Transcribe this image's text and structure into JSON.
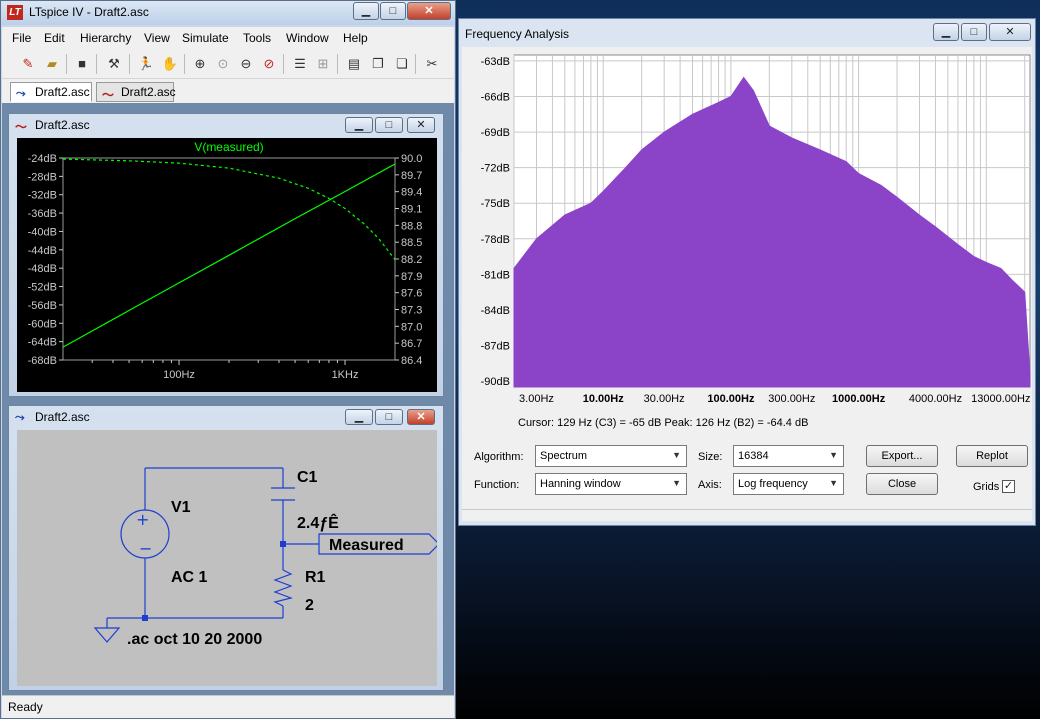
{
  "lt_window": {
    "title": "LTspice IV - Draft2.asc",
    "menu": [
      "File",
      "Edit",
      "Hierarchy",
      "View",
      "Simulate",
      "Tools",
      "Window",
      "Help"
    ],
    "tabs": [
      "Draft2.asc",
      "Draft2.asc"
    ],
    "status": "Ready"
  },
  "plot_window": {
    "title": "Draft2.asc",
    "trace_name": "V(measured)",
    "colors": {
      "trace": "#00ff00",
      "background": "#000000",
      "grid": "#808080"
    }
  },
  "schematic_window": {
    "title": "Draft2.asc",
    "labels": {
      "v1": "V1",
      "ac": "AC 1",
      "c1": "C1",
      "c1_value": "2.4ƒÊ",
      "r1": "R1",
      "r1_value": "2",
      "net": "Measured",
      "directive": ".ac oct 10 20 2000"
    }
  },
  "fa_window": {
    "title": "Frequency Analysis",
    "cursor_text": "Cursor: 129 Hz (C3) = -65 dB   Peak: 126 Hz (B2) = -64.4 dB",
    "algorithm": {
      "label": "Algorithm:",
      "value": "Spectrum"
    },
    "size": {
      "label": "Size:",
      "value": "16384"
    },
    "function": {
      "label": "Function:",
      "value": "Hanning window"
    },
    "axis": {
      "label": "Axis:",
      "value": "Log frequency"
    },
    "buttons": {
      "export": "Export...",
      "replot": "Replot",
      "close": "Close"
    },
    "grids": {
      "label": "Grids",
      "checked": true,
      "check_mark": "✓"
    },
    "colors": {
      "spectrum": "#8b44c8"
    }
  },
  "chart_data": [
    {
      "type": "line",
      "title": "V(measured)",
      "x_scale": "log",
      "x_ticks": [
        "100Hz",
        "1KHz"
      ],
      "y_left_ticks": [
        "-24dB",
        "-28dB",
        "-32dB",
        "-36dB",
        "-40dB",
        "-44dB",
        "-48dB",
        "-52dB",
        "-56dB",
        "-60dB",
        "-64dB",
        "-68dB"
      ],
      "y_right_ticks": [
        "90.0",
        "89.7",
        "89.4",
        "89.1",
        "88.8",
        "88.5",
        "88.2",
        "87.9",
        "87.6",
        "87.3",
        "87.0",
        "86.7",
        "86.4"
      ],
      "xlim": [
        20,
        2000
      ],
      "ylim_left": [
        -68,
        -24
      ],
      "ylim_right": [
        86.4,
        90.0
      ],
      "series": [
        {
          "axis": "left",
          "style": "solid",
          "x": [
            20,
            50,
            100,
            200,
            500,
            1000,
            2000
          ],
          "y": [
            -65.2,
            -57.2,
            -51.2,
            -45.2,
            -37.2,
            -31.3,
            -25.3
          ]
        },
        {
          "axis": "right",
          "style": "dashed",
          "x": [
            20,
            50,
            100,
            200,
            400,
            600,
            800,
            1000,
            1300,
            1600,
            2000
          ],
          "y": [
            89.98,
            89.95,
            89.91,
            89.82,
            89.64,
            89.46,
            89.28,
            89.1,
            88.83,
            88.56,
            88.19
          ]
        }
      ]
    },
    {
      "type": "area",
      "title": "Frequency Analysis",
      "x_scale": "log",
      "x_ticks": [
        "3.00Hz",
        "10.00Hz",
        "30.00Hz",
        "100.00Hz",
        "300.00Hz",
        "1000.00Hz",
        "4000.00Hz",
        "13000.00Hz"
      ],
      "y_ticks": [
        "-63dB",
        "-66dB",
        "-69dB",
        "-72dB",
        "-75dB",
        "-78dB",
        "-81dB",
        "-84dB",
        "-87dB",
        "-90dB"
      ],
      "xlim": [
        2,
        22000
      ],
      "ylim": [
        -90.5,
        -62.5
      ],
      "x": [
        2,
        3,
        5,
        8,
        10,
        15,
        20,
        30,
        50,
        80,
        100,
        126,
        150,
        200,
        300,
        500,
        800,
        1000,
        1500,
        2000,
        3000,
        4000,
        6000,
        8000,
        10000,
        13000,
        16000,
        20000,
        22000
      ],
      "y": [
        -80.5,
        -78.0,
        -76.0,
        -75.0,
        -74.0,
        -72.0,
        -70.5,
        -69.0,
        -67.5,
        -66.5,
        -66.0,
        -64.4,
        -65.5,
        -68.5,
        -69.5,
        -70.5,
        -71.5,
        -72.5,
        -73.5,
        -74.5,
        -76.0,
        -77.0,
        -78.5,
        -79.5,
        -80.0,
        -80.5,
        -81.5,
        -82.5,
        -89.5
      ]
    }
  ]
}
